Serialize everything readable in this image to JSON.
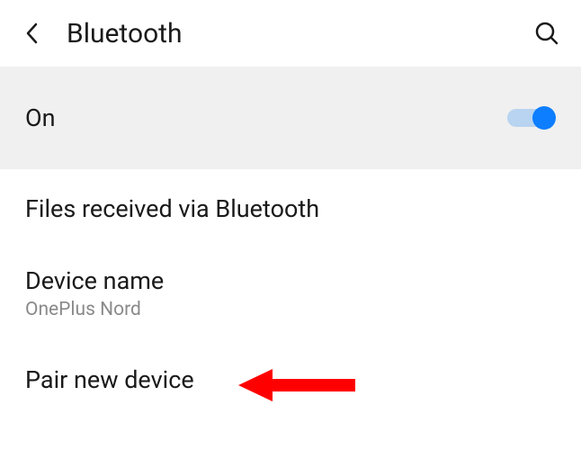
{
  "header": {
    "title": "Bluetooth"
  },
  "bluetooth": {
    "status_label": "On",
    "enabled": true
  },
  "menu": {
    "files_received_label": "Files received via Bluetooth",
    "device_name_label": "Device name",
    "device_name_value": "OnePlus Nord",
    "pair_new_device_label": "Pair new device"
  }
}
